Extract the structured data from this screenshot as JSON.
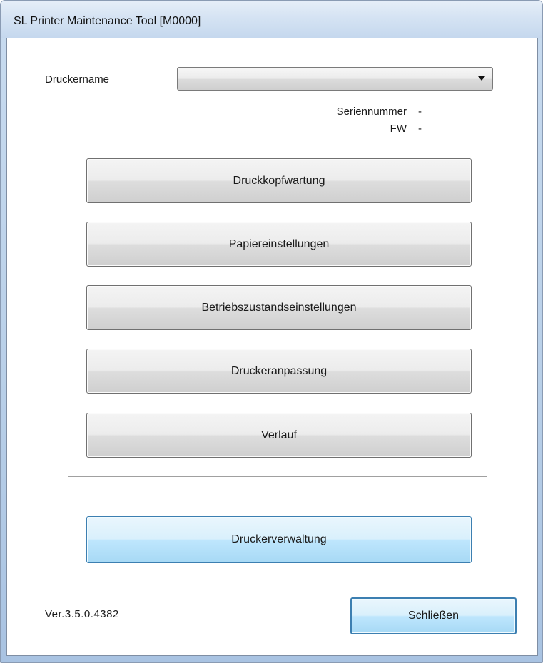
{
  "window": {
    "title": "SL Printer Maintenance Tool [M0000]"
  },
  "printer": {
    "name_label": "Druckername",
    "selected_value": "",
    "serial_label": "Seriennummer",
    "serial_value": "-",
    "fw_label": "FW",
    "fw_value": "-"
  },
  "buttons": {
    "head_maintenance": "Druckkopfwartung",
    "paper_settings": "Papiereinstellungen",
    "operating_settings": "Betriebszustandseinstellungen",
    "printer_adjustment": "Druckeranpassung",
    "history": "Verlauf",
    "printer_management": "Druckerverwaltung",
    "close": "Schließen"
  },
  "footer": {
    "version": "Ver.3.5.0.4382"
  },
  "icons": {
    "dropdown": "chevron-down-icon"
  },
  "colors": {
    "accent_button": "#bee6fd",
    "accent_border": "#3c7fb1"
  }
}
